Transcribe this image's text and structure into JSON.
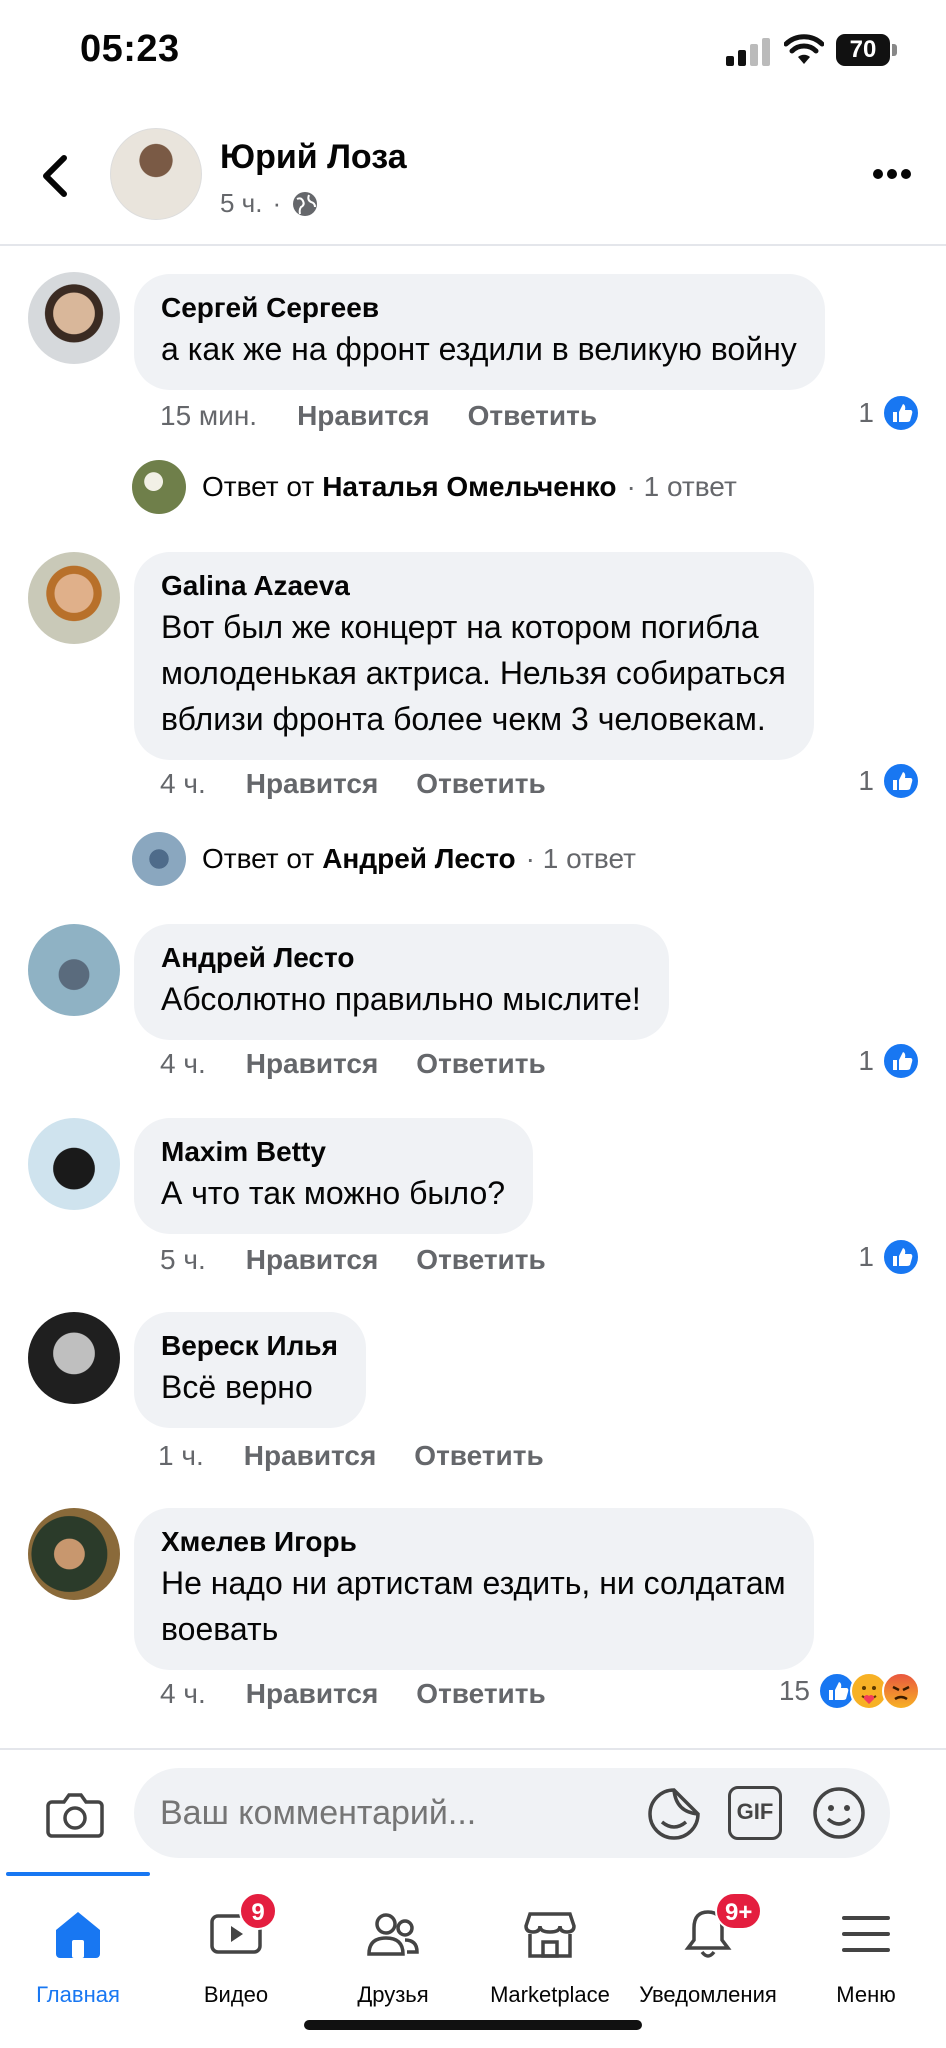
{
  "status_bar": {
    "time": "05:23",
    "battery": "70"
  },
  "header": {
    "author_name": "Юрий Лоза",
    "post_age": "5 ч.",
    "separator": "·"
  },
  "comments": [
    {
      "author": "Сергей Сергеев",
      "text_lines": [
        "а как же на фронт ездили в великую войну"
      ],
      "time": "15 мин.",
      "like_label": "Нравится",
      "reply_label": "Ответить",
      "reaction_count": "1",
      "reply_thread": {
        "prefix": "Ответ от",
        "name": "Наталья Омельченко",
        "count": "· 1 ответ"
      }
    },
    {
      "author": "Galina Azaeva",
      "text_lines": [
        "Вот был же концерт на котором погибла",
        "молоденькая актриса. Нельзя собираться",
        "вблизи фронта более чекм 3 человекам."
      ],
      "time": "4 ч.",
      "like_label": "Нравится",
      "reply_label": "Ответить",
      "reaction_count": "1",
      "reply_thread": {
        "prefix": "Ответ от",
        "name": "Андрей Лесто",
        "count": "· 1 ответ"
      }
    },
    {
      "author": "Андрей Лесто",
      "text_lines": [
        "Абсолютно правильно мыслите!"
      ],
      "time": "4 ч.",
      "like_label": "Нравится",
      "reply_label": "Ответить",
      "reaction_count": "1"
    },
    {
      "author": "Maxim Betty",
      "text_lines": [
        "А что так можно было?"
      ],
      "time": "5 ч.",
      "like_label": "Нравится",
      "reply_label": "Ответить",
      "reaction_count": "1"
    },
    {
      "author": "Вереск Илья",
      "text_lines": [
        "Всё верно"
      ],
      "time": "1 ч.",
      "like_label": "Нравится",
      "reply_label": "Ответить"
    },
    {
      "author": "Хмелев Игорь",
      "text_lines": [
        "Не надо ни артистам ездить, ни солдатам",
        "воевать"
      ],
      "time": "4 ч.",
      "like_label": "Нравится",
      "reply_label": "Ответить",
      "reaction_count": "15"
    }
  ],
  "composer": {
    "placeholder": "Ваш комментарий...",
    "gif_label": "GIF"
  },
  "nav": {
    "home": "Главная",
    "video": "Видео",
    "video_badge": "9",
    "friends": "Друзья",
    "marketplace": "Marketplace",
    "notifications": "Уведомления",
    "notifications_badge": "9+",
    "menu": "Меню"
  },
  "colors": {
    "accent": "#1877f2",
    "bubble": "#f0f2f5",
    "secondary_text": "#65676b",
    "badge_red": "#e41e3f"
  }
}
